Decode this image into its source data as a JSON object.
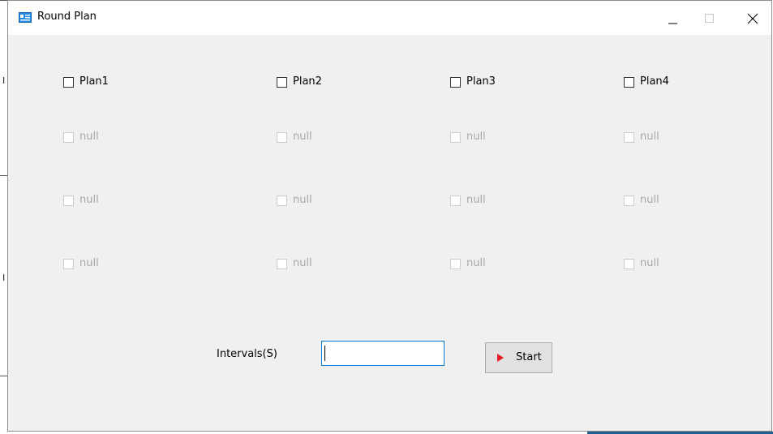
{
  "window": {
    "title": "Round Plan"
  },
  "plans": [
    {
      "label": "Plan1",
      "enabled": true
    },
    {
      "label": "Plan2",
      "enabled": true
    },
    {
      "label": "Plan3",
      "enabled": true
    },
    {
      "label": "Plan4",
      "enabled": true
    }
  ],
  "rows": [
    [
      "null",
      "null",
      "null",
      "null"
    ],
    [
      "null",
      "null",
      "null",
      "null"
    ],
    [
      "null",
      "null",
      "null",
      "null"
    ]
  ],
  "interval": {
    "label": "Intervals(S)",
    "value": ""
  },
  "start_button": {
    "label": "Start"
  },
  "colors": {
    "accent": "#0078d7",
    "play": "#e51c23",
    "disabled_text": "#a8a8a8"
  },
  "icons": {
    "app": "form-window-icon",
    "minimize": "minimize-icon",
    "maximize": "maximize-icon",
    "close": "close-icon",
    "start": "play-icon"
  }
}
